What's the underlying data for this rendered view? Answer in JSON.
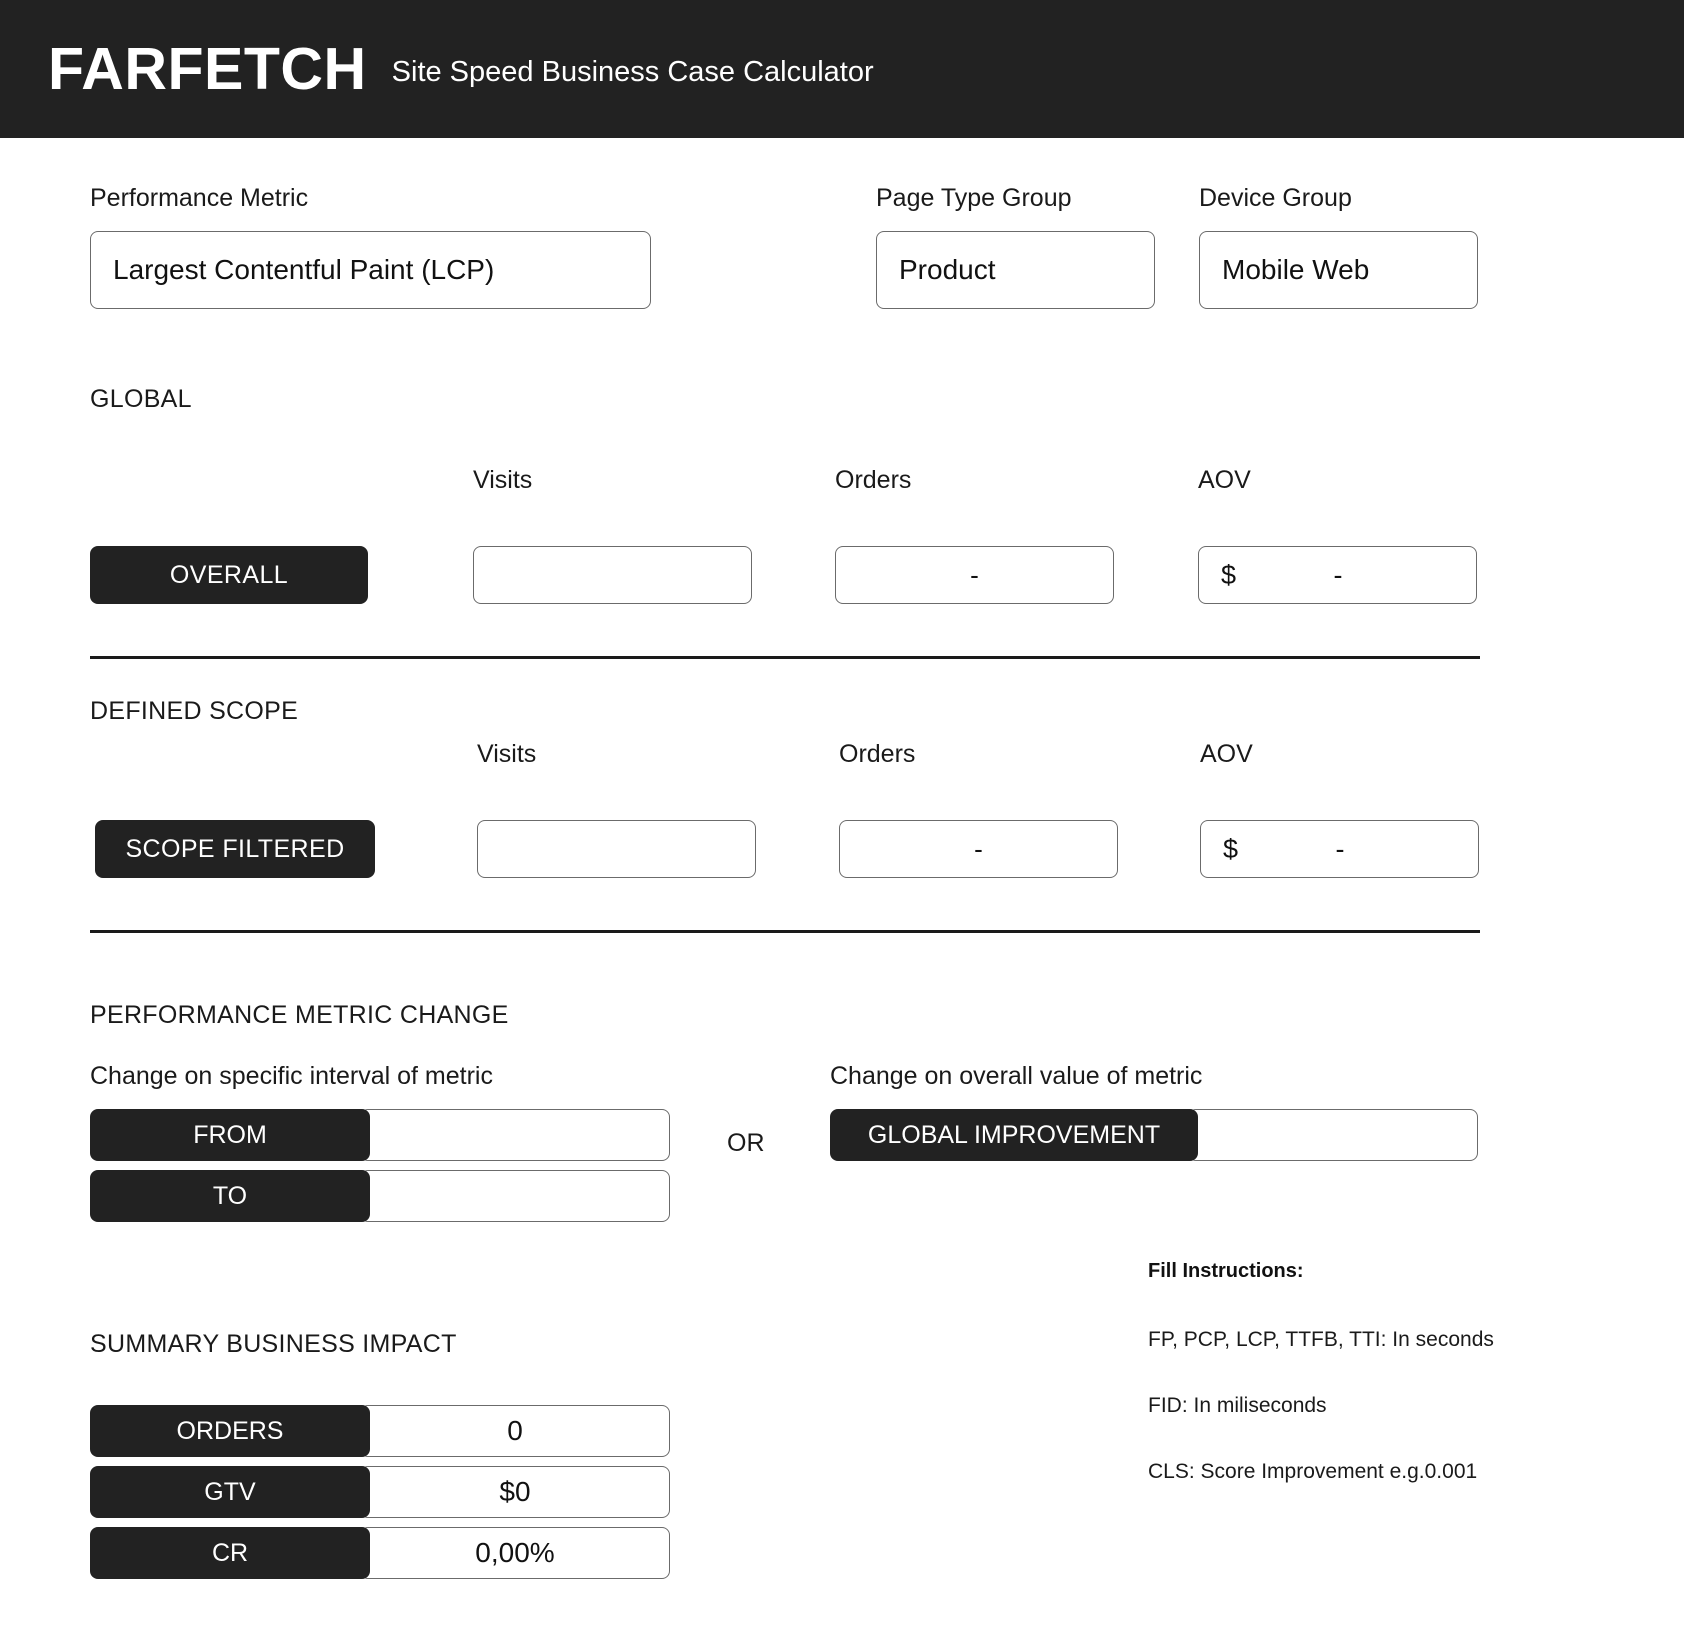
{
  "header": {
    "brand": "FARFETCH",
    "subtitle": "Site Speed Business Case Calculator"
  },
  "selectors": {
    "performance_metric": {
      "label": "Performance Metric",
      "value": "Largest Contentful Paint (LCP)"
    },
    "page_type_group": {
      "label": "Page Type Group",
      "value": "Product"
    },
    "device_group": {
      "label": "Device Group",
      "value": "Mobile Web"
    }
  },
  "global_section": {
    "title": "GLOBAL",
    "button_label": "OVERALL",
    "columns": {
      "visits": "Visits",
      "orders": "Orders",
      "aov": "AOV"
    },
    "values": {
      "visits": "",
      "orders": "-",
      "aov_currency": "$",
      "aov": "-"
    }
  },
  "scope_section": {
    "title": "DEFINED SCOPE",
    "button_label": "SCOPE FILTERED",
    "columns": {
      "visits": "Visits",
      "orders": "Orders",
      "aov": "AOV"
    },
    "values": {
      "visits": "",
      "orders": "-",
      "aov_currency": "$",
      "aov": "-"
    }
  },
  "metric_change": {
    "title": "PERFORMANCE METRIC CHANGE",
    "interval_label": "Change on specific interval of metric",
    "overall_label": "Change on overall value of metric",
    "from_label": "FROM",
    "to_label": "TO",
    "from_value": "",
    "to_value": "",
    "or_label": "OR",
    "global_improvement_label": "GLOBAL IMPROVEMENT",
    "global_improvement_value": ""
  },
  "summary": {
    "title": "SUMMARY BUSINESS IMPACT",
    "rows": [
      {
        "label": "ORDERS",
        "value": "0"
      },
      {
        "label": "GTV",
        "value": "$0"
      },
      {
        "label": "CR",
        "value": "0,00%"
      }
    ]
  },
  "instructions": {
    "title": "Fill Instructions:",
    "lines": [
      "FP, PCP, LCP, TTFB, TTI: In seconds",
      "FID: In miliseconds",
      "CLS: Score Improvement e.g.0.001"
    ]
  },
  "colors": {
    "dark": "#222222",
    "background": "#ffffff",
    "border": "#6b6b6b",
    "text": "#111111"
  }
}
